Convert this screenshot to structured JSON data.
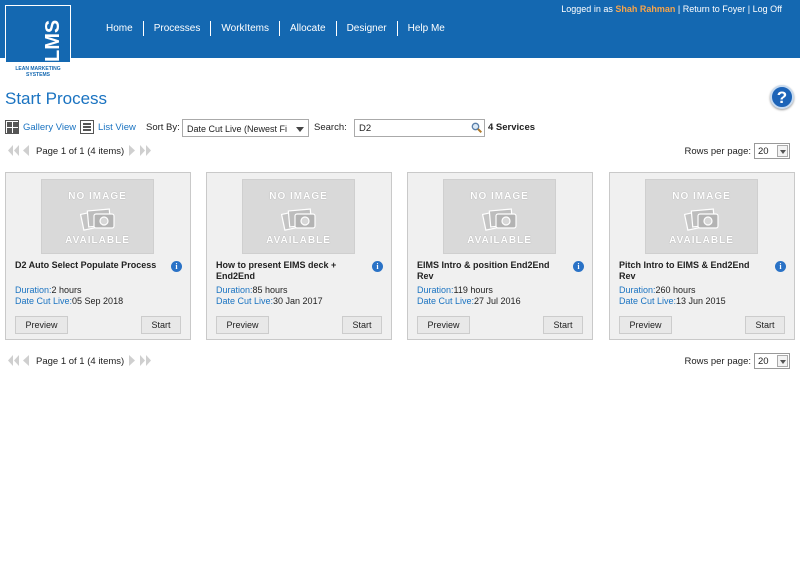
{
  "header": {
    "logo_text": "LMS",
    "logo_sub": "LEAN MARKETING SYSTEMS",
    "nav": [
      "Home",
      "Processes",
      "WorkItems",
      "Allocate",
      "Designer",
      "Help Me"
    ],
    "logged_in_prefix": "Logged in as",
    "user_name": "Shah Rahman",
    "return_link": "Return to Foyer",
    "logout_link": "Log Off",
    "separator": "|"
  },
  "page": {
    "title": "Start Process",
    "help_glyph": "?"
  },
  "toolbar": {
    "gallery_view": "Gallery View",
    "list_view": "List View",
    "sort_label": "Sort By:",
    "sort_value": "Date Cut Live (Newest Fi",
    "search_label": "Search:",
    "search_value": "D2",
    "services_count": "4 Services"
  },
  "pager": {
    "text": "Page 1 of 1 (4 items)",
    "rows_label": "Rows per page:",
    "rows_value": "20"
  },
  "card_labels": {
    "no_image_1": "NO IMAGE",
    "no_image_2": "AVAILABLE",
    "duration_key": "Duration:",
    "date_key": "Date Cut Live:",
    "preview": "Preview",
    "start": "Start",
    "info_glyph": "i"
  },
  "cards": [
    {
      "title": "D2 Auto Select Populate Process",
      "duration": "2 hours",
      "date": "05 Sep 2018"
    },
    {
      "title": "How to present EIMS deck + End2End",
      "duration": "85 hours",
      "date": "30 Jan 2017"
    },
    {
      "title": "EIMS Intro & position End2End Rev",
      "duration": "119 hours",
      "date": "27 Jul 2016"
    },
    {
      "title": "Pitch Intro to EIMS & End2End Rev",
      "duration": "260 hours",
      "date": "13 Jun 2015"
    }
  ],
  "colors": {
    "header_bg": "#1468b1",
    "accent_blue": "#1a73c1",
    "username_orange": "#f7a44a"
  },
  "icons": [
    "grid-icon",
    "list-icon",
    "search-icon",
    "help-icon",
    "info-icon",
    "first-page-icon",
    "prev-page-icon",
    "next-page-icon",
    "last-page-icon"
  ]
}
